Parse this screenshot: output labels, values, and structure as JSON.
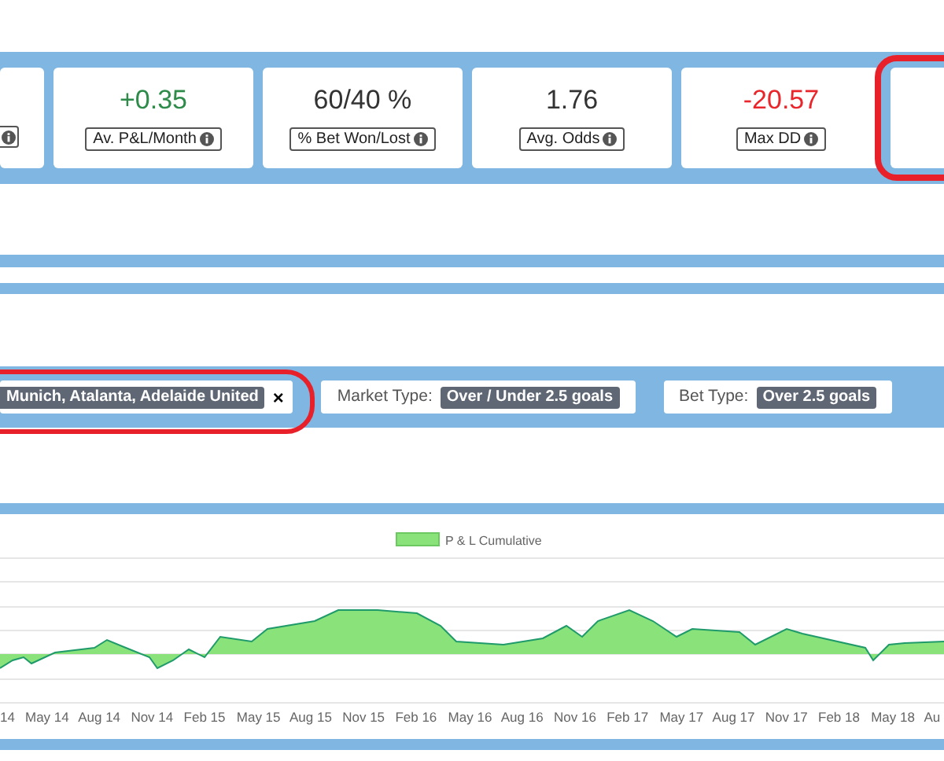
{
  "stat_cards": [
    {
      "kind": "cut"
    },
    {
      "kind": "full",
      "value": "+0.35",
      "color": "#2e8b4a",
      "label": "Av. P&L/Month",
      "highlight": false
    },
    {
      "kind": "full",
      "value": "60/40 %",
      "color": "#333333",
      "label": "% Bet Won/Lost",
      "highlight": false
    },
    {
      "kind": "full",
      "value": "1.76",
      "color": "#333333",
      "label": "Avg. Odds",
      "highlight": false
    },
    {
      "kind": "full",
      "value": "-20.57",
      "color": "#e8262b",
      "label": "Max DD",
      "highlight": false
    },
    {
      "kind": "empty",
      "highlight": true
    }
  ],
  "filters": [
    {
      "value": "Munich, Atalanta, Adelaide United",
      "remove": "×",
      "highlight": true
    },
    {
      "label": "Market Type:",
      "value": "Over / Under 2.5 goals",
      "highlight": false
    },
    {
      "label": "Bet Type:",
      "value": "Over 2.5 goals",
      "highlight": false
    }
  ],
  "chart": {
    "legend": "P & L Cumulative",
    "x_labels": [
      "14",
      "May 14",
      "Aug 14",
      "Nov 14",
      "Feb 15",
      "May 15",
      "Aug 15",
      "Nov 15",
      "Feb 16",
      "May 16",
      "Aug 16",
      "Nov 16",
      "Feb 17",
      "May 17",
      "Aug 17",
      "Nov 17",
      "Feb 18",
      "May 18",
      "Au"
    ]
  }
}
